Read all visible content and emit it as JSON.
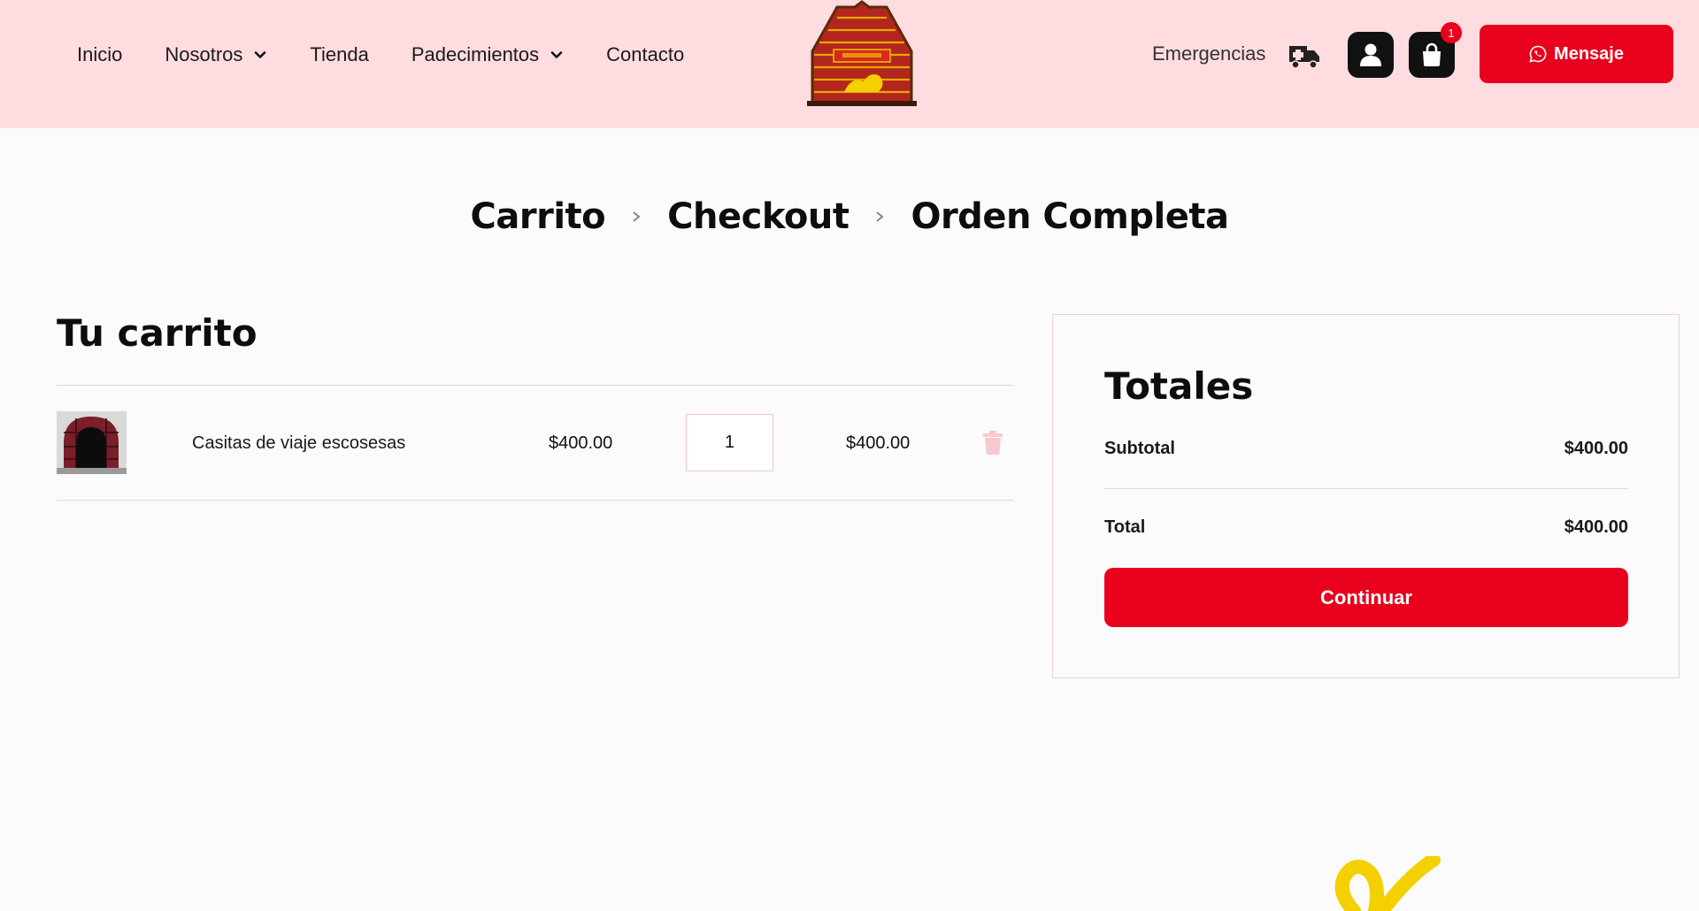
{
  "nav": {
    "items": [
      {
        "label": "Inicio",
        "dropdown": false
      },
      {
        "label": "Nosotros",
        "dropdown": true
      },
      {
        "label": "Tienda",
        "dropdown": false
      },
      {
        "label": "Padecimientos",
        "dropdown": true
      },
      {
        "label": "Contacto",
        "dropdown": false
      }
    ]
  },
  "header": {
    "emergencias_label": "Emergencias",
    "cart_count": "1",
    "message_label": "Mensaje"
  },
  "steps": [
    "Carrito",
    "Checkout",
    "Orden Completa"
  ],
  "cart": {
    "title": "Tu carrito",
    "items": [
      {
        "name": "Casitas de viaje escosesas",
        "price": "$400.00",
        "quantity": "1",
        "subtotal": "$400.00"
      }
    ]
  },
  "totals": {
    "title": "Totales",
    "subtotal_label": "Subtotal",
    "subtotal_value": "$400.00",
    "total_label": "Total",
    "total_value": "$400.00",
    "continue_label": "Continuar"
  },
  "colors": {
    "brand_red": "#e8001c",
    "header_bg": "#fedcdf",
    "page_bg": "#fbfbfb",
    "accent_yellow": "#f5d000"
  }
}
